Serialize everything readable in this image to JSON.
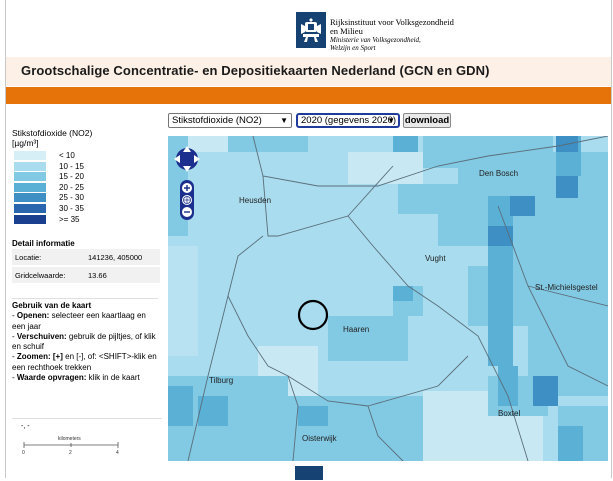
{
  "header": {
    "org_line1": "Rijksinstituut voor Volksgezondheid",
    "org_line2": "en Milieu",
    "org_line3": "Ministerie van Volksgezondheid,",
    "org_line4": "Welzijn en Sport",
    "title": "Grootschalige Concentratie- en Depositiekaarten Nederland (GCN en GDN)"
  },
  "controls": {
    "layer_value": "Stikstofdioxide (NO2)",
    "year_value": "2020 (gegevens 2020)",
    "download_label": "download"
  },
  "legend": {
    "title": "Stikstofdioxide (NO2)",
    "unit": "[µg/m³]",
    "items": [
      {
        "label": "< 10",
        "color": "#d6eff7"
      },
      {
        "label": "10 - 15",
        "color": "#a8dcee"
      },
      {
        "label": "15 - 20",
        "color": "#82c9e3"
      },
      {
        "label": "20 - 25",
        "color": "#5bb0d6"
      },
      {
        "label": "25 - 30",
        "color": "#3d8fc4"
      },
      {
        "label": "30 - 35",
        "color": "#2a66ad"
      },
      {
        "label": ">= 35",
        "color": "#1b3f8f"
      }
    ]
  },
  "detail": {
    "title": "Detail informatie",
    "rows": [
      {
        "key": "Locatie:",
        "value": "141236, 405000"
      },
      {
        "key": "Gridcelwaarde:",
        "value": "13.66"
      }
    ]
  },
  "help": {
    "title": "Gebruik van de kaart",
    "lines": [
      {
        "bold": "Openen:",
        "text": " selecteer een kaartlaag en een jaar"
      },
      {
        "bold": "Verschuiven:",
        "text": " gebruik de pijltjes, of klik en schuif"
      },
      {
        "bold": "Zoomen: [+]",
        "text": " en [-], of: <SHIFT>-klik en een rechthoek trekken"
      },
      {
        "bold": "Waarde opvragen:",
        "text": " klik in de kaart"
      }
    ]
  },
  "scale": {
    "coords": "-, -",
    "label": "kilometers",
    "ticks": [
      "0",
      "2",
      "4"
    ]
  },
  "map": {
    "places": [
      "Heusden",
      "Den Bosch",
      "Vught",
      "St.-Michielsgestel",
      "Haaren",
      "Tilburg",
      "Boxtel",
      "Oisterwijk"
    ]
  },
  "colors": {
    "brand": "#154273",
    "orange": "#e6720a",
    "title_band": "#fdf0e6"
  }
}
